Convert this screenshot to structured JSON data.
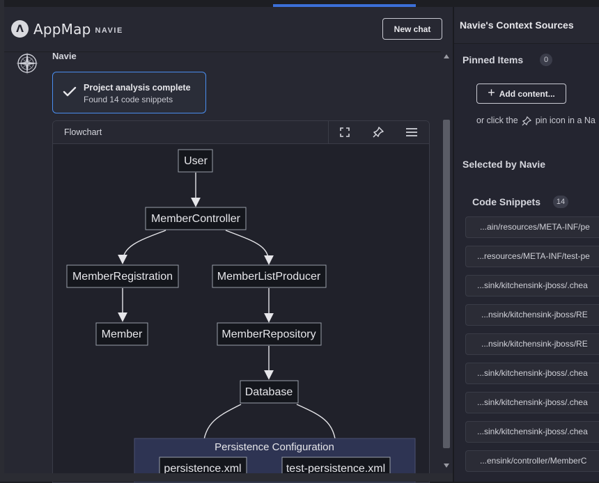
{
  "app": {
    "logo_text": "AppMap",
    "logo_sub": "NAVIE",
    "logo_mark": "Λ",
    "new_chat_label": "New chat"
  },
  "message": {
    "author": "Navie",
    "status": {
      "title": "Project analysis complete",
      "subtitle": "Found 14 code snippets"
    }
  },
  "flowchart": {
    "title": "Flowchart",
    "toolbar": [
      "expand-icon",
      "pin-icon",
      "menu-icon"
    ],
    "nodes": {
      "user": "User",
      "member_controller": "MemberController",
      "member_registration": "MemberRegistration",
      "member_list_producer": "MemberListProducer",
      "member": "Member",
      "member_repository": "MemberRepository",
      "database": "Database",
      "persistence_group": "Persistence Configuration",
      "persistence_xml": "persistence.xml",
      "test_persistence_xml": "test-persistence.xml"
    }
  },
  "sidebar": {
    "title": "Navie's Context Sources",
    "pinned": {
      "label": "Pinned Items",
      "count": "0",
      "add_label": "Add content...",
      "hint_before": "or click the",
      "hint_after": "pin icon in a Na"
    },
    "selected": {
      "label": "Selected by Navie"
    },
    "snippets": {
      "label": "Code Snippets",
      "count": "14",
      "items": [
        "...ain/resources/META-INF/pe",
        "...resources/META-INF/test-pe",
        "...sink/kitchensink-jboss/.chea",
        "...nsink/kitchensink-jboss/RE",
        "...nsink/kitchensink-jboss/RE",
        "...sink/kitchensink-jboss/.chea",
        "...sink/kitchensink-jboss/.chea",
        "...sink/kitchensink-jboss/.chea",
        "...ensink/controller/MemberC"
      ]
    }
  },
  "colors": {
    "accent": "#3b6fd8",
    "status_border": "#4a8ef0",
    "node_bg": "#14161c",
    "node_border": "#9aa0aa",
    "group_bg": "#2e3453"
  }
}
